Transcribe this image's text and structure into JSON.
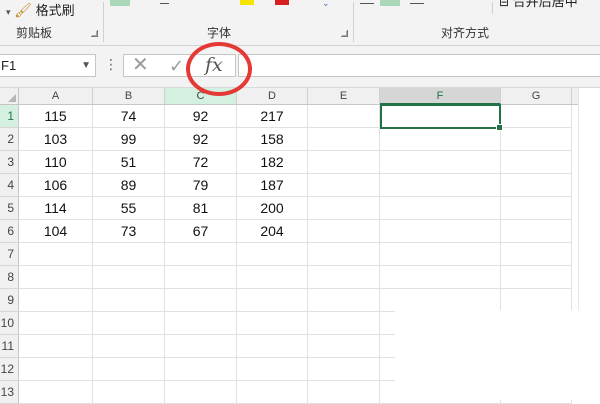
{
  "ribbon": {
    "format_painter": "格式刷",
    "groups": {
      "clipboard": "剪贴板",
      "font": "字体",
      "alignment": "对齐方式"
    },
    "merge_center_partial": "合并后居中"
  },
  "formula_bar": {
    "name_box": "F1",
    "cancel_symbol": "✕",
    "enter_symbol": "✓",
    "fx_label": "fx",
    "value": ""
  },
  "grid": {
    "columns": [
      "A",
      "B",
      "C",
      "D",
      "E",
      "F",
      "G"
    ],
    "selected_column": "F",
    "selected_cell": "F1",
    "row_headers": [
      "1",
      "2",
      "3",
      "4",
      "5",
      "6",
      "7",
      "8",
      "9",
      "10",
      "11",
      "12",
      "13"
    ],
    "rows": [
      [
        "115",
        "74",
        "92",
        "217"
      ],
      [
        "103",
        "99",
        "92",
        "158"
      ],
      [
        "110",
        "51",
        "72",
        "182"
      ],
      [
        "106",
        "89",
        "79",
        "187"
      ],
      [
        "114",
        "55",
        "81",
        "200"
      ],
      [
        "104",
        "73",
        "67",
        "204"
      ]
    ]
  },
  "colors": {
    "accent": "#217346",
    "highlight_circle": "#e53935",
    "header_bg": "#f0f0f0",
    "selected_header_bg": "#d3f0e0"
  }
}
